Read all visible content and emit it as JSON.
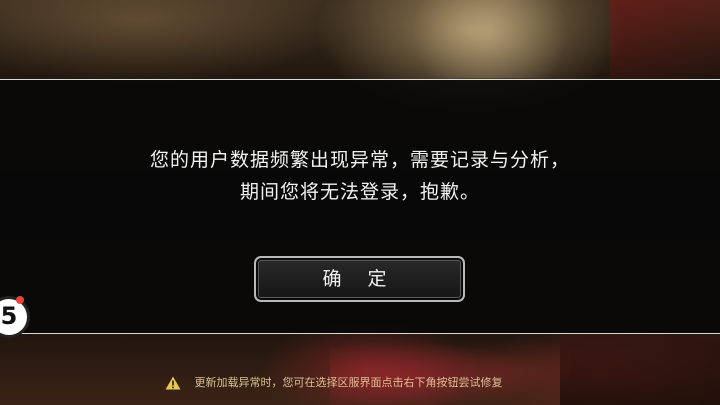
{
  "dialog": {
    "message_line1": "您的用户数据频繁出现异常，需要记录与分析，",
    "message_line2": "期间您将无法登录，抱歉。",
    "confirm_label": "确 定"
  },
  "float_badge": {
    "glyph": "5",
    "icon": "floating-assistant-icon"
  },
  "bottom_hint": {
    "icon": "warning-icon",
    "text": "更新加载异常时，您可在选择区服界面点击右下角按钮尝试修复"
  },
  "colors": {
    "dialog_text": "#f2f2f2",
    "hint_text": "#ebd2a0",
    "warning": "#e8c45a",
    "badge_dot": "#e8453c"
  }
}
